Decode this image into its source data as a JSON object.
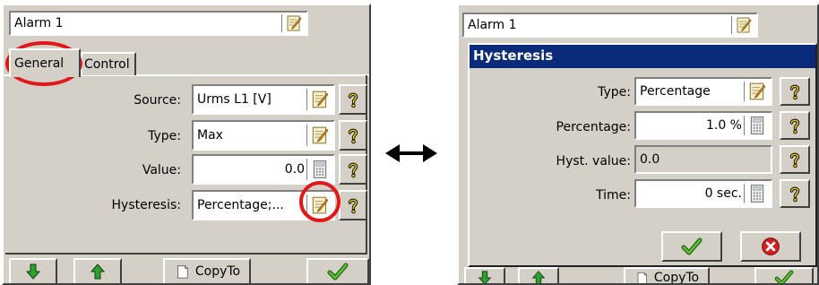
{
  "left_panel": {
    "name_value": "Alarm 1",
    "tabs": [
      {
        "label": "General"
      },
      {
        "label": "Control"
      }
    ],
    "rows": [
      {
        "label": "Source:",
        "value": "Urms L1 [V]"
      },
      {
        "label": "Type:",
        "value": "Max"
      },
      {
        "label": "Value:",
        "value": "0.0"
      },
      {
        "label": "Hysteresis:",
        "value": "Percentage;..."
      }
    ],
    "bottom": {
      "copyto_label": "CopyTo"
    }
  },
  "right_panel": {
    "name_value": "Alarm 1",
    "dialog": {
      "title": "Hysteresis",
      "rows": [
        {
          "label": "Type:",
          "value": "Percentage"
        },
        {
          "label": "Percentage:",
          "value": "1.0 %"
        },
        {
          "label": "Hyst. value:",
          "value": "0.0"
        },
        {
          "label": "Time:",
          "value": "0 sec."
        }
      ]
    },
    "bottom": {
      "copyto_label": "CopyTo"
    }
  },
  "icons": {
    "edit": "pencil-notepad-icon",
    "calculator": "calculator-icon",
    "help": "question-mark-icon",
    "ok": "checkmark-icon",
    "cancel": "red-x-icon",
    "arrow": "double-headed-arrow-icon"
  },
  "colors": {
    "titlebar": "#0a2a7a",
    "highlight_circle": "#e01818",
    "ok_green": "#3aa020",
    "cancel_red": "#d02020",
    "help_yellow": "#f0d000"
  }
}
